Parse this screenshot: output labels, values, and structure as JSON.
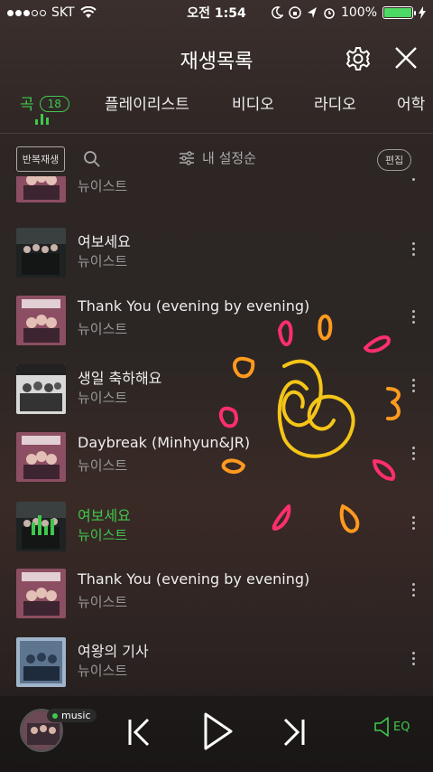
{
  "status_bar": {
    "carrier": "SKT",
    "time": "오전 1:54",
    "battery_text": "100%",
    "battery_level": 1.0,
    "battery_color": "#4cd964"
  },
  "header": {
    "title": "재생목록",
    "settings_icon": "gear-icon",
    "close_icon": "close-icon"
  },
  "tabs": [
    {
      "label": "곡",
      "badge": "18",
      "active": true
    },
    {
      "label": "플레이리스트"
    },
    {
      "label": "비디오"
    },
    {
      "label": "라디오"
    },
    {
      "label": "어학"
    }
  ],
  "toolbar": {
    "repeat_label": "반복재생",
    "sort_label": "내 설정순",
    "edit_label": "편집"
  },
  "songs": [
    {
      "title": "",
      "artist": "뉴이스트",
      "art": "pink"
    },
    {
      "title": "여보세요",
      "artist": "뉴이스트",
      "art": "dark"
    },
    {
      "title": "Thank You (evening by evening)",
      "artist": "뉴이스트",
      "art": "pink"
    },
    {
      "title": "생일 축하해요",
      "artist": "뉴이스트",
      "art": "bw"
    },
    {
      "title": "Daybreak (Minhyun&JR)",
      "artist": "뉴이스트",
      "art": "pink"
    },
    {
      "title": "여보세요",
      "artist": "뉴이스트",
      "art": "dark",
      "playing": true
    },
    {
      "title": "Thank You (evening by evening)",
      "artist": "뉴이스트",
      "art": "pink"
    },
    {
      "title": "여왕의 기사",
      "artist": "뉴이스트",
      "art": "blue"
    }
  ],
  "player": {
    "badge_label": "music",
    "eq_label": "EQ",
    "accent_color": "#3ec84c"
  }
}
